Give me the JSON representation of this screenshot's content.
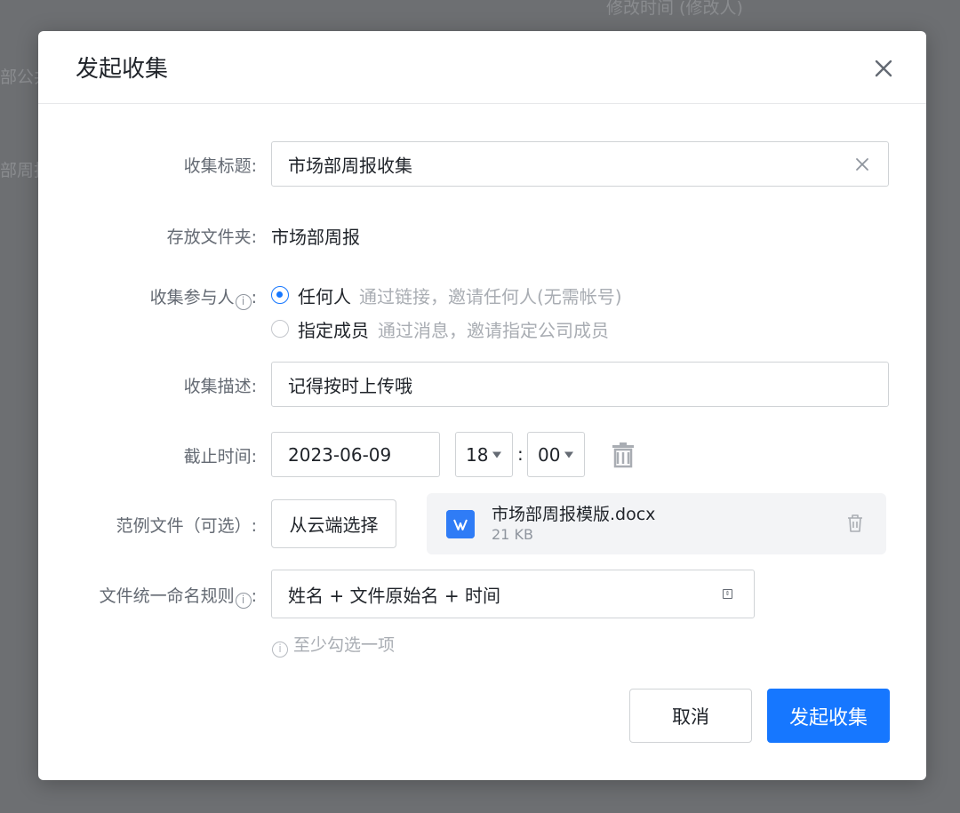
{
  "background": {
    "header_text": "修改时间 (修改人)",
    "row1_text": "部公共",
    "row2_text": "部周报"
  },
  "dialog": {
    "title": "发起收集",
    "close_icon": "close-icon"
  },
  "form": {
    "title_label": "收集标题:",
    "title_value": "市场部周报收集",
    "folder_label": "存放文件夹:",
    "folder_value": "市场部周报",
    "participants_label": "收集参与人",
    "participants_label_colon": ":",
    "participants_options": [
      {
        "label": "任何人",
        "hint": "通过链接，邀请任何人(无需帐号)",
        "selected": true
      },
      {
        "label": "指定成员",
        "hint": "通过消息，邀请指定公司成员",
        "selected": false
      }
    ],
    "description_label": "收集描述:",
    "description_value": "记得按时上传哦",
    "deadline_label": "截止时间:",
    "deadline_date": "2023-06-09",
    "deadline_hour": "18",
    "time_separator": ":",
    "deadline_minute": "00",
    "sample_label": "范例文件（可选）:",
    "sample_button": "从云端选择",
    "sample_file": {
      "name": "市场部周报模版.docx",
      "size": "21 KB",
      "icon": "word-doc-icon"
    },
    "naming_label": "文件统一命名规则",
    "naming_label_colon": ":",
    "naming_value": "姓名 + 文件原始名 + 时间",
    "naming_hint": "至少勾选一项",
    "info_glyph": "i"
  },
  "footer": {
    "cancel_label": "取消",
    "submit_label": "发起收集"
  },
  "colors": {
    "primary": "#1677ff",
    "overlay": "#6d6f72"
  }
}
